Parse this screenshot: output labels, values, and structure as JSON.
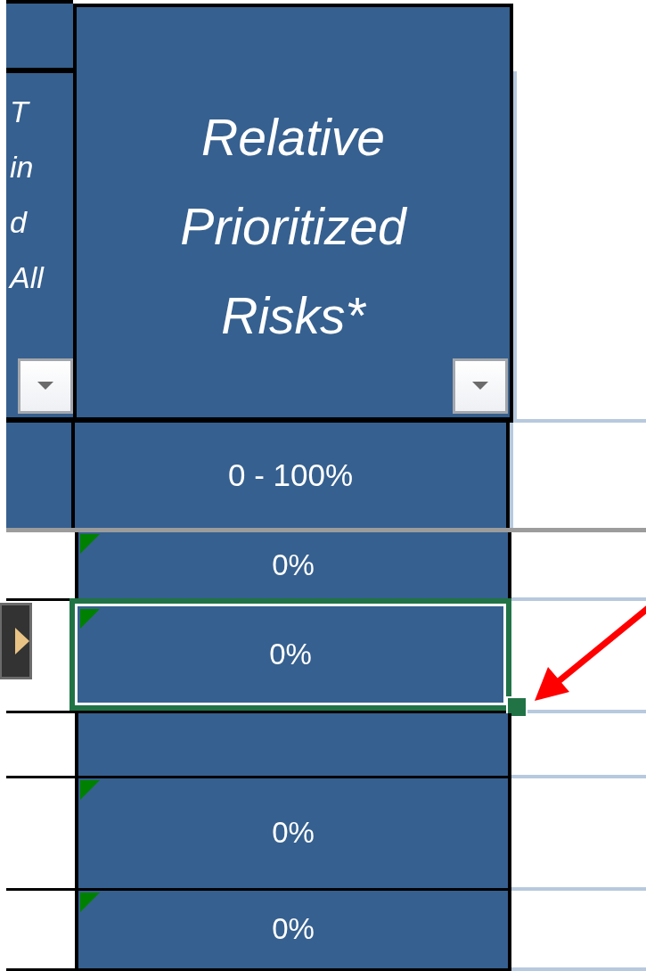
{
  "header": {
    "left_column_fragments": [
      "T",
      "in",
      "d",
      "All"
    ],
    "title": "Relative Prioritized Risks*"
  },
  "units": "0 - 100%",
  "rows": [
    {
      "value": "0%",
      "error_indicator": true,
      "selected": false,
      "row_button": false
    },
    {
      "value": "0%",
      "error_indicator": true,
      "selected": true,
      "row_button": true
    },
    {
      "error_indicator": false,
      "selected": false,
      "row_button": false
    },
    {
      "value": "0%",
      "error_indicator": true,
      "selected": false,
      "row_button": false
    },
    {
      "value": "0%",
      "error_indicator": true,
      "selected": false,
      "row_button": false
    }
  ]
}
